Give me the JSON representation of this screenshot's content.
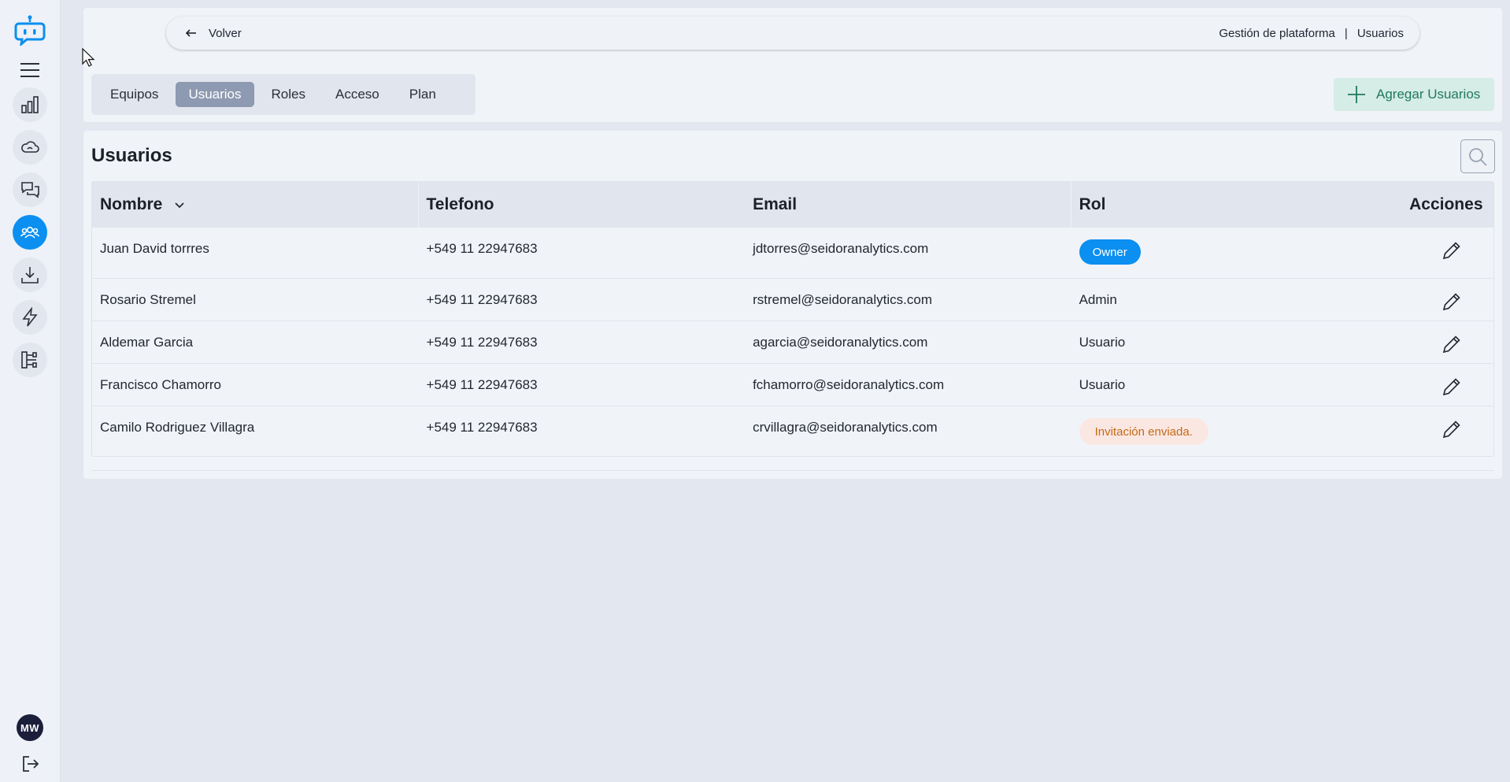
{
  "sidebar": {
    "items": [
      {
        "icon": "bar-chart-icon",
        "active": false
      },
      {
        "icon": "cloud-icon",
        "active": false
      },
      {
        "icon": "chat-icon",
        "active": false
      },
      {
        "icon": "users-icon",
        "active": true
      },
      {
        "icon": "download-icon",
        "active": false
      },
      {
        "icon": "lightning-icon",
        "active": false
      },
      {
        "icon": "flow-icon",
        "active": false
      }
    ],
    "avatar_initials": "MW"
  },
  "breadcrumb": {
    "back_label": "Volver",
    "section": "Gestión de plataforma",
    "separator": "|",
    "current": "Usuarios"
  },
  "tabs": [
    {
      "label": "Equipos",
      "active": false
    },
    {
      "label": "Usuarios",
      "active": true
    },
    {
      "label": "Roles",
      "active": false
    },
    {
      "label": "Acceso",
      "active": false
    },
    {
      "label": "Plan",
      "active": false
    }
  ],
  "add_button_label": "Agregar Usuarios",
  "page_title": "Usuarios",
  "table": {
    "columns": [
      "Nombre",
      "Telefono",
      "Email",
      "Rol",
      "Acciones"
    ],
    "rows": [
      {
        "name": "Juan David torrres",
        "phone": "+549 11 22947683",
        "email": "jdtorres@seidoranalytics.com",
        "role": "Owner"
      },
      {
        "name": "Rosario Stremel",
        "phone": "+549 11 22947683",
        "email": "rstremel@seidoranalytics.com",
        "role": "Admin"
      },
      {
        "name": "Aldemar Garcia",
        "phone": "+549 11 22947683",
        "email": "agarcia@seidoranalytics.com",
        "role": "Usuario"
      },
      {
        "name": "Francisco Chamorro",
        "phone": "+549 11 22947683",
        "email": "fchamorro@seidoranalytics.com",
        "role": "Usuario"
      },
      {
        "name": "Camilo Rodriguez Villagra",
        "phone": "+549 11 22947683",
        "email": "crvillagra@seidoranalytics.com",
        "role": "Invitación enviada."
      }
    ]
  },
  "colors": {
    "accent": "#0b8ff0",
    "active_tab": "#8d9ab1",
    "add_button_bg": "#d6ece6",
    "add_button_text": "#1f7a5c",
    "invite_badge_bg": "#fbe7e2",
    "invite_badge_text": "#c36a18"
  }
}
